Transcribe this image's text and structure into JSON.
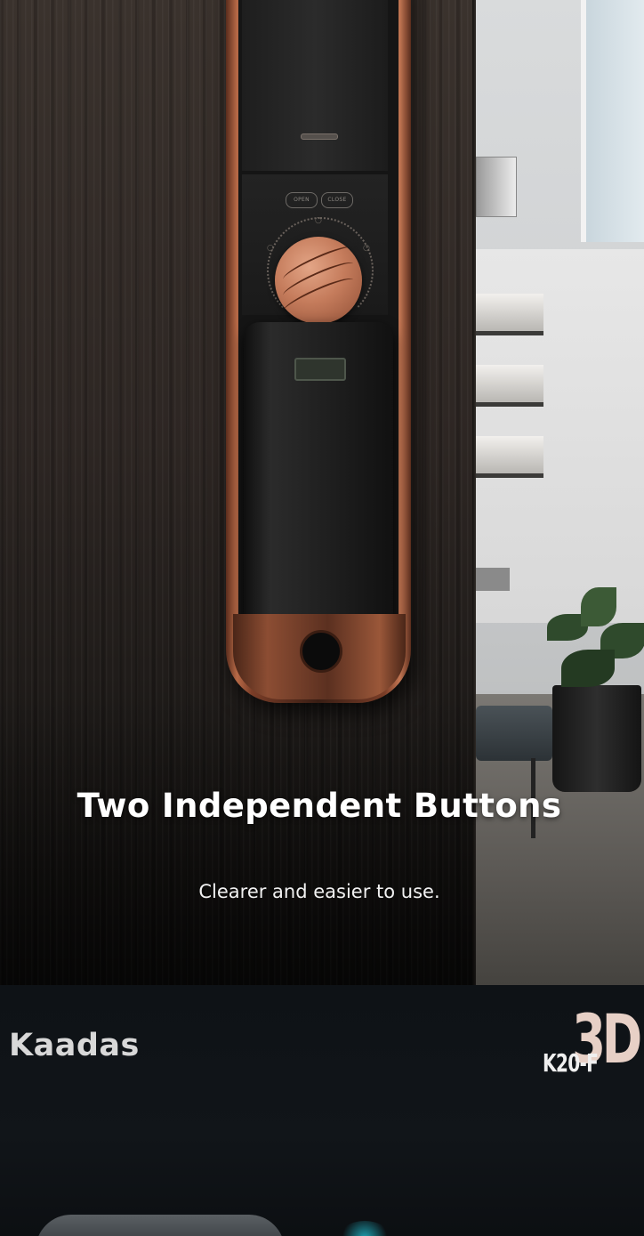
{
  "hero": {
    "title": "Two Independent Buttons",
    "subtitle": "Clearer and easier to use."
  },
  "lock": {
    "open_label": "OPEN",
    "close_label": "CLOSE"
  },
  "banner": {
    "brand": "Kaadas",
    "model": "K20-F",
    "model_suffix": "3D"
  },
  "colors": {
    "accent_copper": "#c57c5c",
    "banner_bg": "#0e1216",
    "title_text": "#ffffff"
  }
}
